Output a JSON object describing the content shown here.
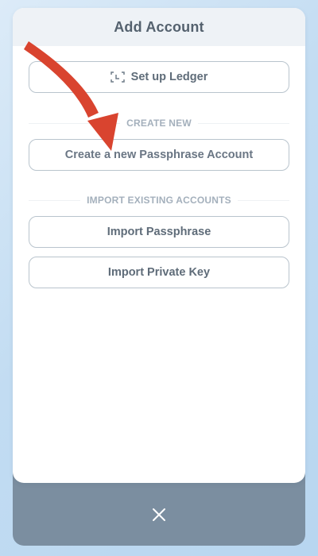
{
  "modal": {
    "title": "Add Account"
  },
  "buttons": {
    "setup_ledger": "Set up Ledger",
    "create_passphrase": "Create a new Passphrase Account",
    "import_passphrase": "Import Passphrase",
    "import_private_key": "Import Private Key"
  },
  "sections": {
    "create_new": "CREATE NEW",
    "import_existing": "IMPORT EXISTING ACCOUNTS"
  },
  "icons": {
    "ledger": "ledger-icon",
    "close": "close-icon",
    "annotation": "red-arrow-annotation"
  },
  "colors": {
    "annotation_arrow": "#d9442f",
    "bottom_sheet": "#7b8ea0",
    "header_background": "#eef2f6",
    "title_text": "#54616e",
    "button_border": "#b9c4cd",
    "section_label": "#a4b0bc"
  }
}
